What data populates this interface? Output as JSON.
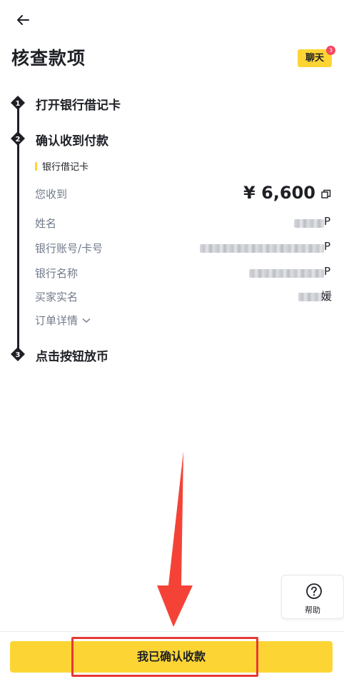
{
  "header": {
    "back_icon": "arrow-left-icon",
    "title": "核查款项",
    "chat_label": "聊天",
    "chat_badge": "3"
  },
  "steps": [
    {
      "number": "1",
      "label": "打开银行借记卡"
    },
    {
      "number": "2",
      "label": "确认收到付款"
    },
    {
      "number": "3",
      "label": "点击按钮放币"
    }
  ],
  "payment": {
    "method": "银行借记卡",
    "received_label": "您收到",
    "amount": "¥ 6,600",
    "fields": [
      {
        "label": "姓名",
        "value_tail": "P"
      },
      {
        "label": "银行账号/卡号",
        "value_tail": "P"
      },
      {
        "label": "银行名称",
        "value_tail": "P"
      },
      {
        "label": "买家实名",
        "value_tail": "媛"
      }
    ],
    "order_details": "订单详情"
  },
  "help": {
    "label": "帮助",
    "icon": "question-circle-icon"
  },
  "footer": {
    "confirm_label": "我已确认收款"
  },
  "colors": {
    "accent": "#fcd535",
    "badge": "#f6465d",
    "annotation": "#e53935"
  }
}
